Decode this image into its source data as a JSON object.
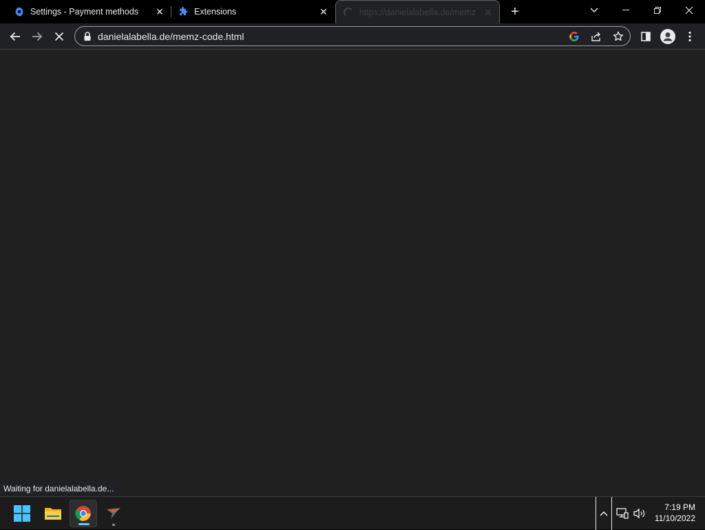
{
  "window": {
    "tabs": [
      {
        "title": "Settings - Payment methods",
        "favicon": "gear-icon",
        "state": "normal"
      },
      {
        "title": "Extensions",
        "favicon": "puzzle-icon",
        "state": "normal"
      },
      {
        "title": "https://danielalabella.de/memz",
        "favicon": "loading-spinner-icon",
        "state": "active-loading"
      }
    ],
    "new_tab_label": "+",
    "controls": [
      "tab-search",
      "minimize",
      "restore",
      "close"
    ]
  },
  "toolbar": {
    "url": "danielalabella.de/memz-code.html",
    "nav_buttons": [
      "back",
      "forward",
      "stop"
    ],
    "omnibox_actions": [
      "google-lens",
      "share",
      "bookmark-star"
    ],
    "right_actions": [
      "side-panel",
      "profile",
      "menu"
    ]
  },
  "content": {
    "background": "#202020"
  },
  "status": {
    "text": "Waiting for danielalabella.de..."
  },
  "taskbar": {
    "apps": [
      {
        "name": "start",
        "icon": "windows-logo-icon"
      },
      {
        "name": "file-explorer",
        "icon": "folder-icon"
      },
      {
        "name": "chrome",
        "icon": "chrome-icon",
        "active": true
      },
      {
        "name": "app",
        "icon": "bird-app-icon",
        "running": true
      }
    ],
    "tray": [
      "show-hidden-icons",
      "network-icon",
      "volume-icon"
    ],
    "clock": {
      "time": "7:19 PM",
      "date": "11/10/2022"
    }
  },
  "colors": {
    "accent": "#60cdff",
    "tab_bg": "#000000",
    "toolbar_bg": "#202124",
    "text": "#e8eaed"
  }
}
